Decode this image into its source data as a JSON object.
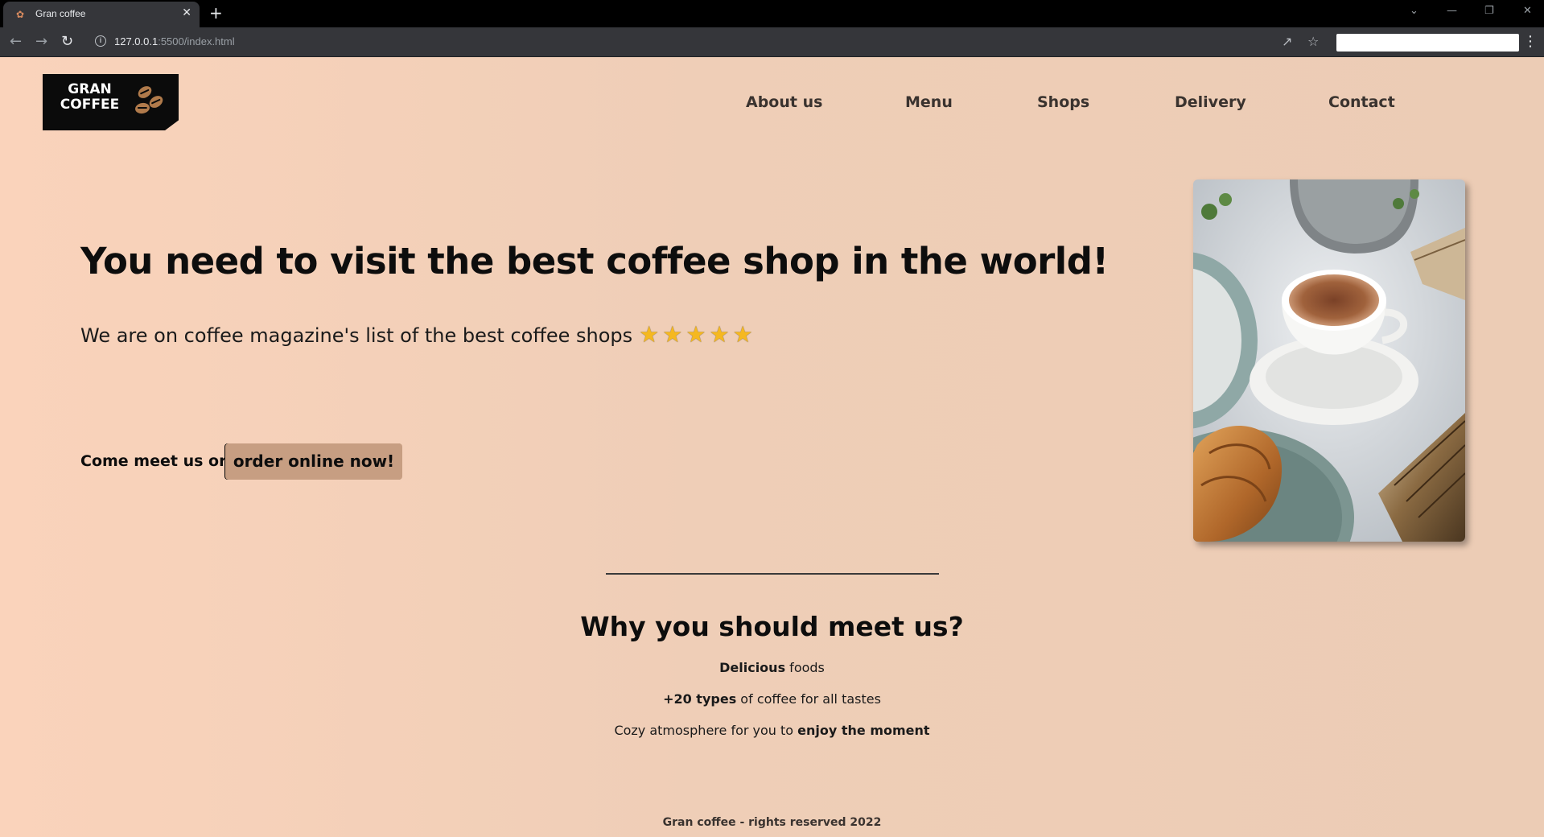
{
  "browser": {
    "tab_title": "Gran coffee",
    "url_host": "127.0.0.1",
    "url_rest": ":5500/index.html"
  },
  "header": {
    "logo_line1": "GRAN",
    "logo_line2": "COFFEE",
    "nav": [
      "About us",
      "Menu",
      "Shops",
      "Delivery",
      "Contact"
    ]
  },
  "hero": {
    "title": "You need to visit the best coffee shop in the world!",
    "subtitle": "We are on coffee magazine's list of the best coffee shops",
    "rating_stars": 5,
    "cta_text": "Come meet us or",
    "cta_button": "order online now!"
  },
  "why": {
    "title": "Why you should meet us?",
    "line1_bold": "Delicious",
    "line1_rest": " foods",
    "line2_bold": "+20 types",
    "line2_rest": " of coffee for all tastes",
    "line3_rest": "Cozy atmosphere for you to ",
    "line3_bold": "enjoy the moment"
  },
  "footer": {
    "text": "Gran coffee - rights reserved 2022"
  },
  "colors": {
    "background_left": "#fad3bb",
    "background_right": "#ecccb5",
    "button": "#c79e82",
    "stars": "#f5b820"
  }
}
